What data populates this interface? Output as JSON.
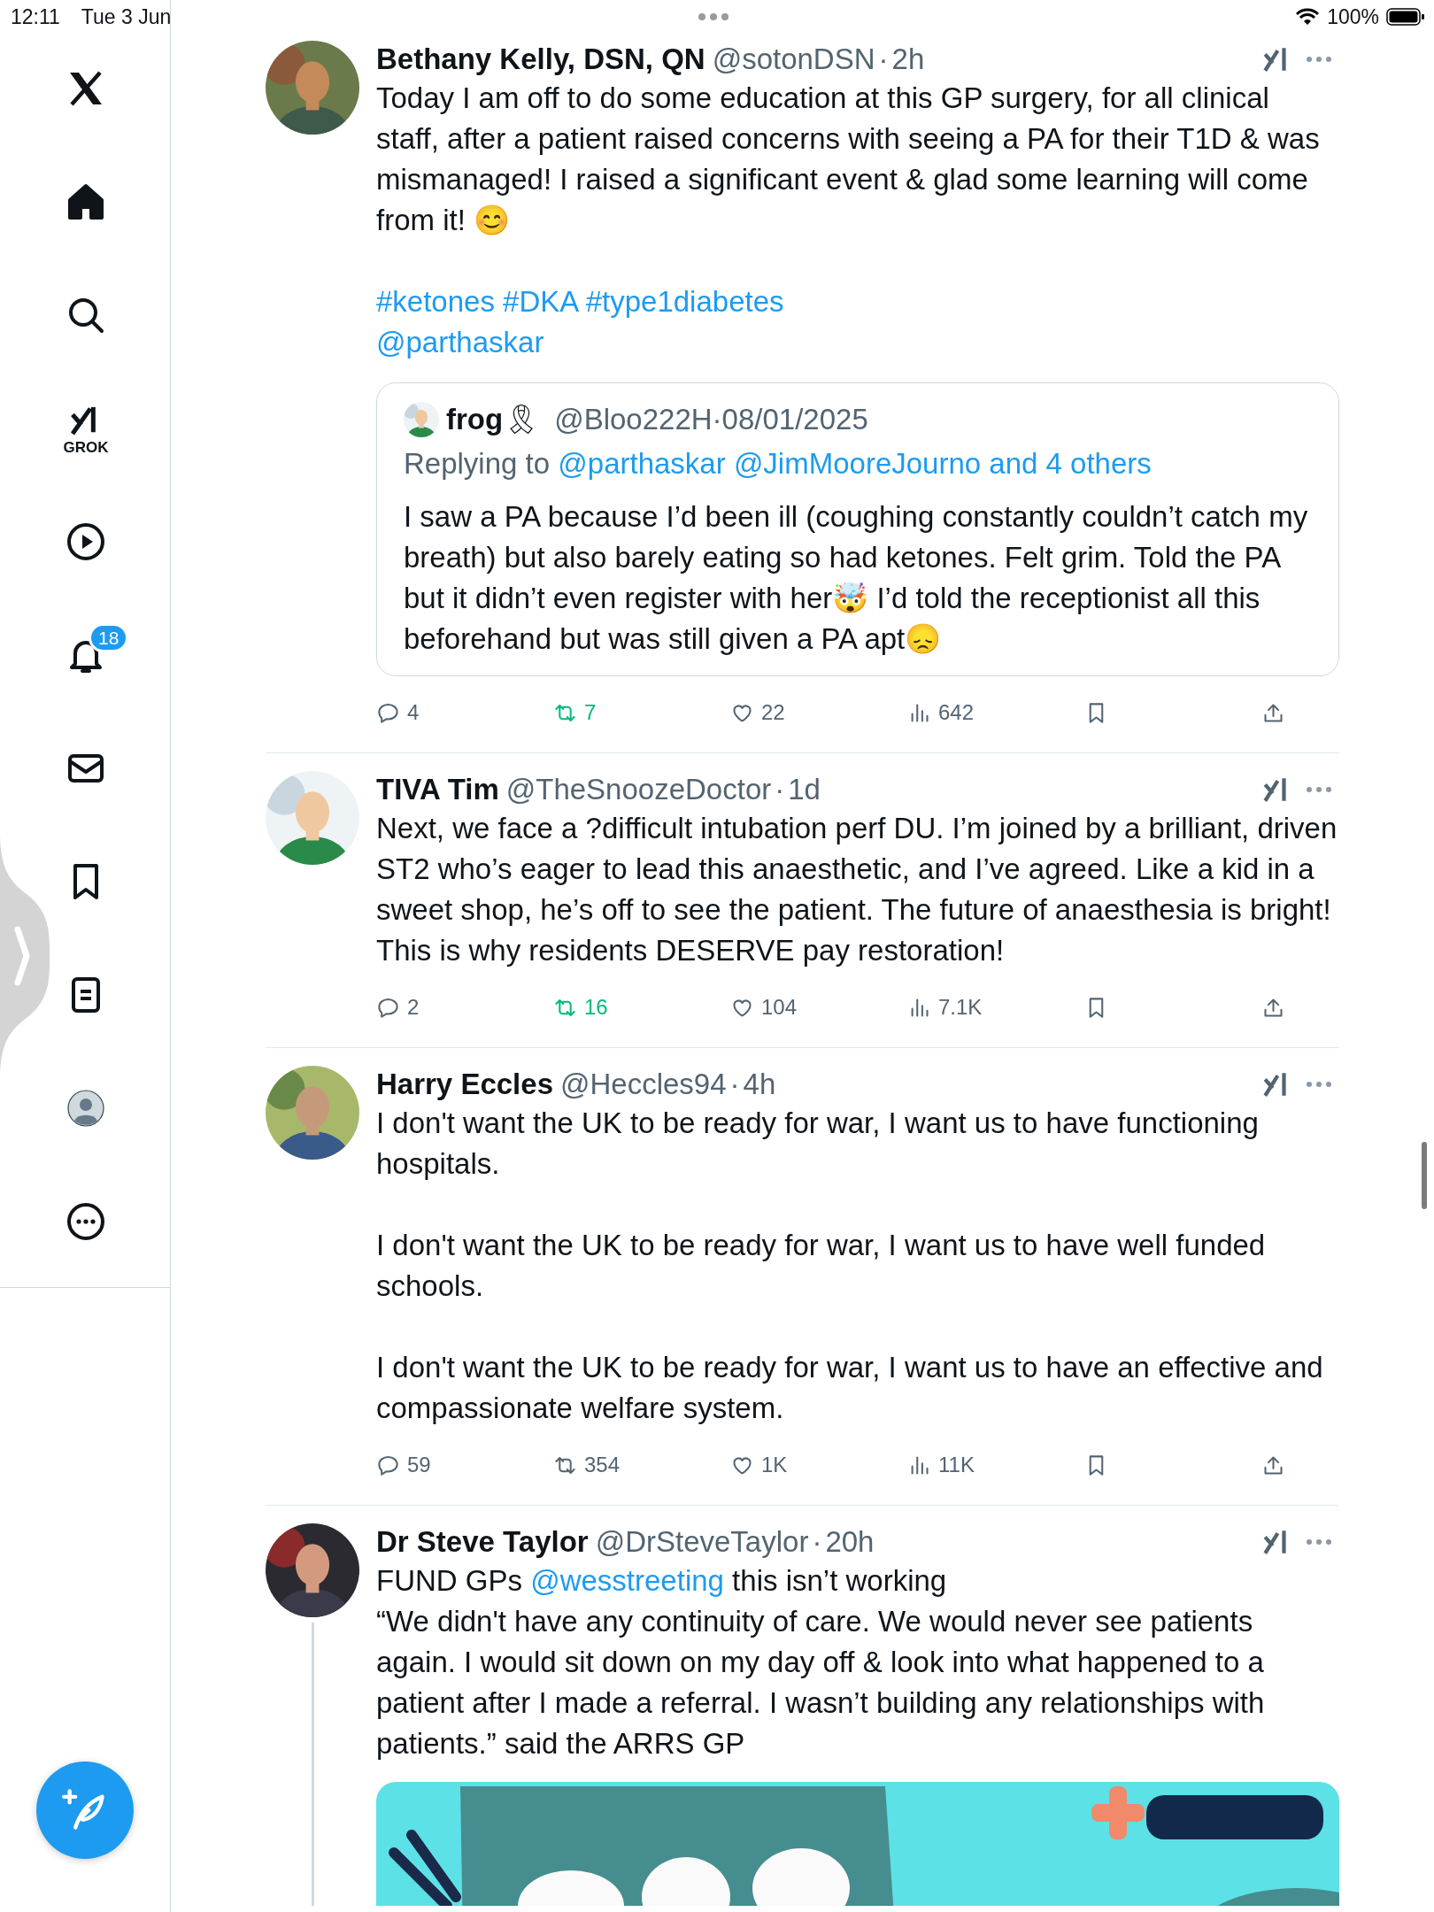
{
  "status_bar": {
    "time": "12:11",
    "date": "Tue 3 Jun",
    "battery": "100%"
  },
  "sidebar": {
    "items": [
      {
        "kind": "logo",
        "selected": false
      },
      {
        "kind": "home",
        "selected": true
      },
      {
        "kind": "search",
        "selected": false
      },
      {
        "kind": "grok",
        "label": "GROK",
        "selected": false
      },
      {
        "kind": "video",
        "selected": false
      },
      {
        "kind": "notifications",
        "badge": "18",
        "selected": false
      },
      {
        "kind": "messages",
        "selected": false
      },
      {
        "kind": "bookmarks",
        "selected": false
      },
      {
        "kind": "lists",
        "selected": false
      },
      {
        "kind": "profile",
        "selected": false
      },
      {
        "kind": "more",
        "selected": false
      }
    ]
  },
  "posts": [
    {
      "name": "Bethany Kelly, DSN, QN",
      "handle": "@sotonDSN",
      "separator": "·",
      "time": "2h",
      "thread": false,
      "paragraphs": [
        [
          {
            "segments": [
              {
                "kind": "text",
                "text": "Today I am off to do some education at this GP surgery, for all clinical staff, after a patient raised concerns with seeing a PA for their T1D & was mismanaged! I raised a significant event & glad some learning will come from it! 😊"
              }
            ]
          }
        ],
        [
          {
            "segments": [
              {
                "kind": "hashtag",
                "text": "#ketones"
              },
              {
                "kind": "hashtag",
                "text": "#DKA"
              },
              {
                "kind": "hashtag",
                "text": "#type1diabetes"
              }
            ]
          },
          {
            "segments": [
              {
                "kind": "mention",
                "text": "@parthaskar"
              }
            ]
          }
        ]
      ],
      "quote": {
        "name": "frog",
        "badge": "🎗",
        "handle": "@Bloo222H",
        "separator": "·",
        "date": "08/01/2025",
        "replying_label": "Replying to",
        "replying_links": [
          "@parthaskar",
          "@JimMooreJourno",
          "and 4 others"
        ],
        "text": "I saw a PA because I’d been ill (coughing constantly couldn’t catch my breath) but also barely eating so had ketones. Felt grim. Told the PA but it didn’t even register with her🤯 I’d told the receptionist all this beforehand but was still given a PA apt😞"
      },
      "actions": [
        {
          "kind": "reply",
          "count": "4",
          "active": false
        },
        {
          "kind": "repost",
          "count": "7",
          "active": true
        },
        {
          "kind": "like",
          "count": "22",
          "active": false
        },
        {
          "kind": "views",
          "count": "642",
          "active": false
        },
        {
          "kind": "bookmark",
          "active": false
        },
        {
          "kind": "share",
          "active": false
        }
      ]
    },
    {
      "name": "TIVA Tim",
      "handle": "@TheSnoozeDoctor",
      "separator": "·",
      "time": "1d",
      "thread": false,
      "paragraphs": [
        [
          {
            "segments": [
              {
                "kind": "text",
                "text": "Next, we face a ?difficult intubation perf DU. I’m joined by a brilliant, driven ST2 who’s eager to lead this anaesthetic, and I’ve agreed. Like a kid in a sweet shop, he’s off to see the patient. The future of anaesthesia is bright! This is why residents DESERVE pay restoration!"
              }
            ]
          }
        ]
      ],
      "actions": [
        {
          "kind": "reply",
          "count": "2",
          "active": false
        },
        {
          "kind": "repost",
          "count": "16",
          "active": true
        },
        {
          "kind": "like",
          "count": "104",
          "active": false
        },
        {
          "kind": "views",
          "count": "7.1K",
          "active": false
        },
        {
          "kind": "bookmark",
          "active": false
        },
        {
          "kind": "share",
          "active": false
        }
      ]
    },
    {
      "name": "Harry Eccles",
      "handle": "@Heccles94",
      "separator": "·",
      "time": "4h",
      "thread": false,
      "paragraphs": [
        [
          {
            "segments": [
              {
                "kind": "text",
                "text": "I don't want the UK to be ready for war, I want us to have functioning hospitals."
              }
            ]
          }
        ],
        [
          {
            "segments": [
              {
                "kind": "text",
                "text": "I don't want the UK to be ready for war, I want us to have well funded schools."
              }
            ]
          }
        ],
        [
          {
            "segments": [
              {
                "kind": "text",
                "text": "I don't want the UK to be ready for war, I want us to have an effective and compassionate welfare system."
              }
            ]
          }
        ]
      ],
      "actions": [
        {
          "kind": "reply",
          "count": "59",
          "active": false
        },
        {
          "kind": "repost",
          "count": "354",
          "active": false
        },
        {
          "kind": "like",
          "count": "1K",
          "active": false
        },
        {
          "kind": "views",
          "count": "11K",
          "active": false
        },
        {
          "kind": "bookmark",
          "active": false
        },
        {
          "kind": "share",
          "active": false
        }
      ]
    },
    {
      "name": "Dr Steve Taylor",
      "handle": "@DrSteveTaylor",
      "separator": "·",
      "time": "20h",
      "thread": true,
      "paragraphs": [
        [
          {
            "segments": [
              {
                "kind": "text",
                "text": "FUND GPs"
              },
              {
                "kind": "mention",
                "text": "@wesstreeting"
              },
              {
                "kind": "text",
                "text": "this isn’t working"
              }
            ]
          },
          {
            "segments": [
              {
                "kind": "text",
                "text": "“We didn't have any continuity of care. We would never see patients again. I would sit down on my day off & look into what happened to a patient after I made a referral. I wasn’t building any relationships with patients.” said the ARRS GP"
              }
            ]
          }
        ]
      ],
      "media": {
        "kind": "picture"
      }
    }
  ]
}
